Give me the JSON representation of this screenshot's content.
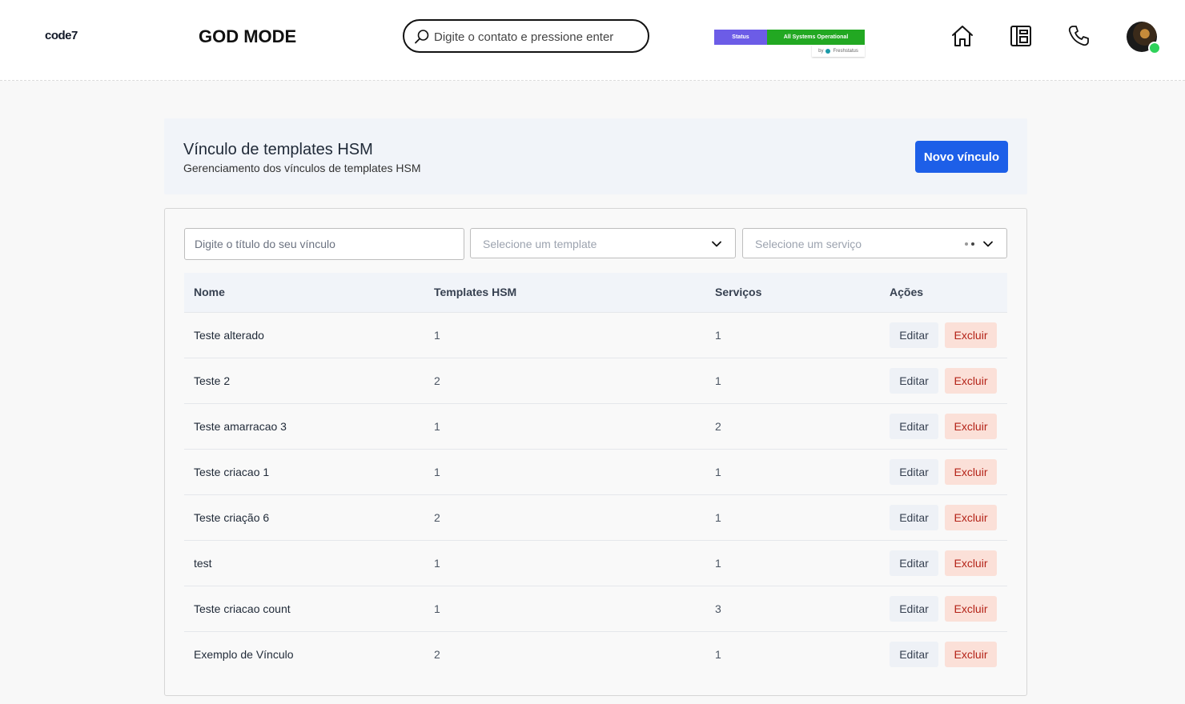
{
  "app": {
    "logo": "code7",
    "mode_title": "GOD MODE"
  },
  "search": {
    "placeholder": "Digite o contato e pressione enter"
  },
  "status_widget": {
    "status_label": "Status",
    "status_value": "All Systems Operational",
    "by_label": "by",
    "provider": "Freshstatus",
    "colors": {
      "status": "#6c5ce7",
      "operational": "#22a822"
    }
  },
  "nav": {
    "icons": [
      "home-icon",
      "layout-icon",
      "phone-icon"
    ],
    "avatar_status": "online"
  },
  "header": {
    "title": "Vínculo de templates HSM",
    "subtitle": "Gerenciamento dos vínculos de templates HSM",
    "new_button": "Novo vínculo"
  },
  "filters": {
    "title_placeholder": "Digite o título do seu vínculo",
    "template_placeholder": "Selecione um template",
    "service_placeholder": "Selecione um serviço"
  },
  "table": {
    "columns": [
      "Nome",
      "Templates HSM",
      "Serviços",
      "Ações"
    ],
    "edit_label": "Editar",
    "delete_label": "Excluir",
    "rows": [
      {
        "name": "Teste alterado",
        "templates": "1",
        "services": "1"
      },
      {
        "name": "Teste 2",
        "templates": "2",
        "services": "1"
      },
      {
        "name": "Teste amarracao 3",
        "templates": "1",
        "services": "2"
      },
      {
        "name": "Teste criacao 1",
        "templates": "1",
        "services": "1"
      },
      {
        "name": "Teste criação 6",
        "templates": "2",
        "services": "1"
      },
      {
        "name": "test",
        "templates": "1",
        "services": "1"
      },
      {
        "name": "Teste criacao count",
        "templates": "1",
        "services": "3"
      },
      {
        "name": "Exemplo de Vínculo",
        "templates": "2",
        "services": "1"
      }
    ]
  },
  "colors": {
    "primary": "#1d5fe8",
    "danger_bg": "#fbe0d8",
    "danger_text": "#b42318",
    "online": "#2fd25a"
  }
}
